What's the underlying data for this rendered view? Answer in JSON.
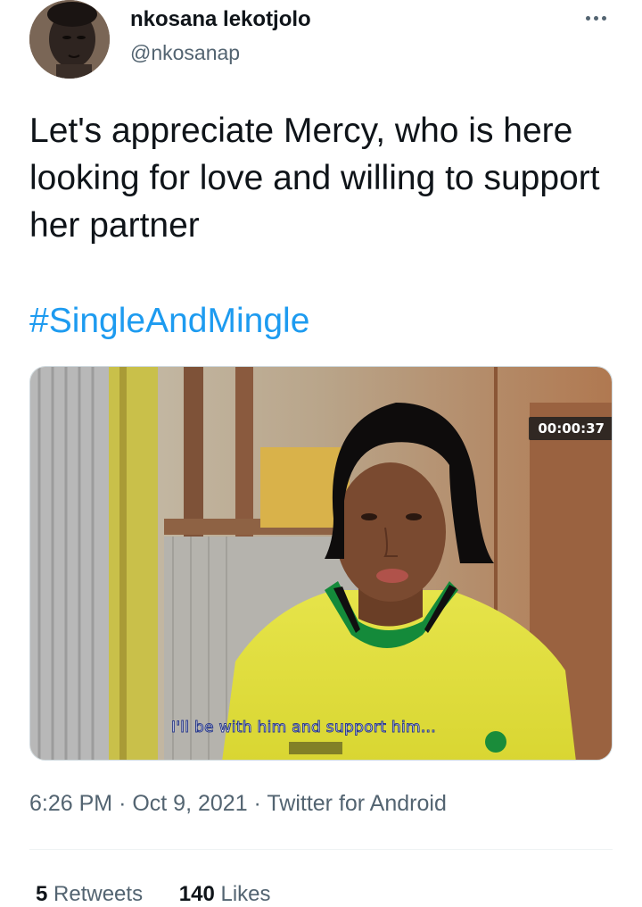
{
  "author": {
    "display_name": "nkosana lekotjolo",
    "handle": "@nkosanap"
  },
  "tweet": {
    "text": "Let's appreciate Mercy, who is here looking for love and willing to support her partner",
    "hashtag": "#SingleAndMingle"
  },
  "media": {
    "timestamp": "00:00:37",
    "subtitle": "I'll be with him and support him..."
  },
  "meta": {
    "time": "6:26 PM",
    "date": "Oct 9, 2021",
    "source": "Twitter for Android",
    "separator": "·"
  },
  "stats": {
    "retweets_count": "5",
    "retweets_label": "Retweets",
    "likes_count": "140",
    "likes_label": "Likes"
  },
  "colors": {
    "link": "#1d9bf0",
    "secondary_text": "#536471",
    "primary_text": "#0f1419"
  }
}
